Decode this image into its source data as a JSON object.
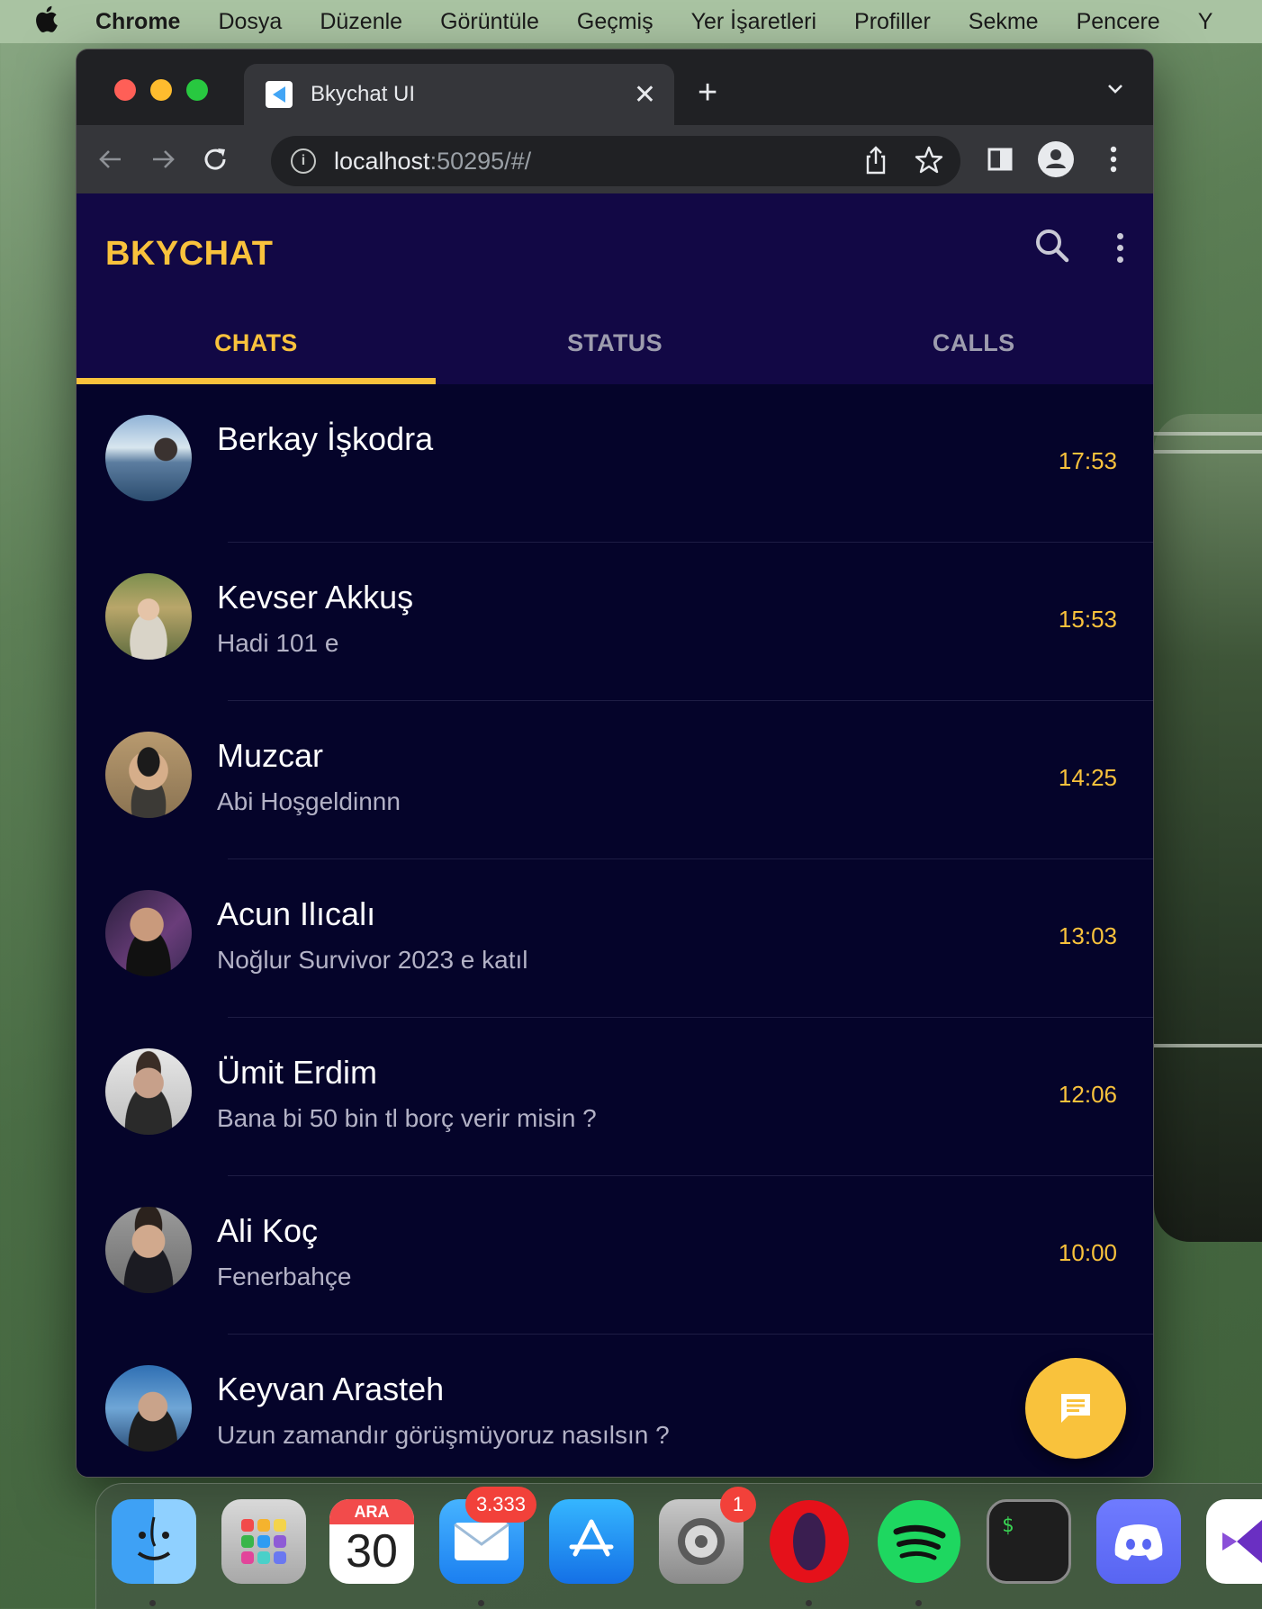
{
  "menubar": {
    "app_name": "Chrome",
    "items": [
      "Dosya",
      "Düzenle",
      "Görüntüle",
      "Geçmiş",
      "Yer İşaretleri",
      "Profiller",
      "Sekme",
      "Pencere",
      "Y"
    ]
  },
  "browser": {
    "tab_title": "Bkychat UI",
    "url_host": "localhost",
    "url_rest": ":50295/#/"
  },
  "app": {
    "title": "BKYCHAT",
    "tabs": [
      "CHATS",
      "STATUS",
      "CALLS"
    ],
    "selected_tab": "CHATS",
    "accent_color": "#f9c23c",
    "chats": [
      {
        "name": "Berkay İşkodra",
        "message": "",
        "time": "17:53"
      },
      {
        "name": "Kevser Akkuş",
        "message": "Hadi 101 e",
        "time": "15:53"
      },
      {
        "name": "Muzcar",
        "message": "Abi Hoşgeldinnn",
        "time": "14:25"
      },
      {
        "name": "Acun Ilıcalı",
        "message": "Noğlur Survivor 2023 e katıl",
        "time": "13:03"
      },
      {
        "name": "Ümit Erdim",
        "message": "Bana bi 50 bin tl borç verir misin ?",
        "time": "12:06"
      },
      {
        "name": "Ali Koç",
        "message": "Fenerbahçe",
        "time": "10:00"
      },
      {
        "name": "Keyvan Arasteh",
        "message": "Uzun zamandır görüşmüyoruz nasılsın ?",
        "time": ""
      }
    ]
  },
  "dock": {
    "calendar_month": "ARA",
    "calendar_day": "30",
    "mail_badge": "3.333",
    "settings_badge": "1"
  }
}
